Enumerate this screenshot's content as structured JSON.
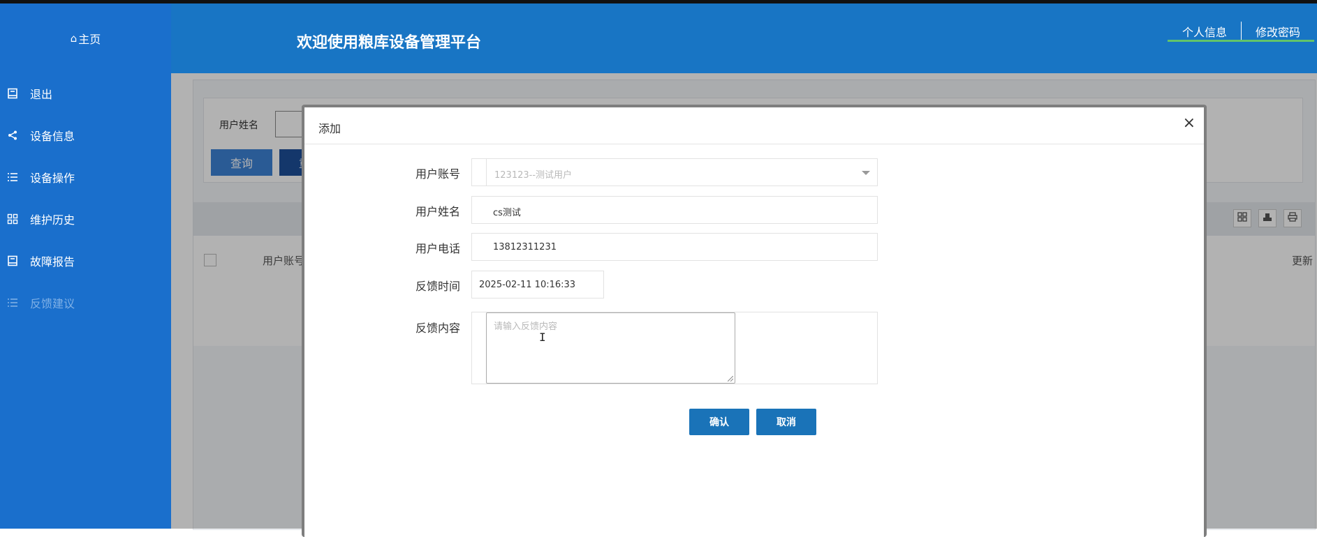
{
  "header": {
    "home_label": "主页",
    "title": "欢迎使用粮库设备管理平台",
    "links": [
      "个人信息",
      "修改密码"
    ]
  },
  "sidebar": {
    "items": [
      {
        "label": "退出",
        "icon": "book-icon"
      },
      {
        "label": "设备信息",
        "icon": "share-icon"
      },
      {
        "label": "设备操作",
        "icon": "list-icon"
      },
      {
        "label": "维护历史",
        "icon": "grid-icon"
      },
      {
        "label": "故障报告",
        "icon": "book-icon"
      },
      {
        "label": "反馈建议",
        "icon": "list-icon",
        "active": true
      }
    ]
  },
  "search": {
    "label": "用户姓名",
    "query_button": "查询",
    "reset_button": "重置"
  },
  "table": {
    "columns": [
      "用户账号",
      "更新"
    ]
  },
  "modal": {
    "title": "添加",
    "close": "×",
    "fields": {
      "account": {
        "label": "用户账号",
        "value": "123123--测试用户"
      },
      "name": {
        "label": "用户姓名",
        "value": "cs测试"
      },
      "phone": {
        "label": "用户电话",
        "value": "13812311231"
      },
      "time": {
        "label": "反馈时间",
        "value": "2025-02-11 10:16:33"
      },
      "content": {
        "label": "反馈内容",
        "placeholder": "请输入反馈内容",
        "value": ""
      }
    },
    "confirm_button": "确认",
    "cancel_button": "取消"
  },
  "colors": {
    "header": "#1875c4",
    "sidebar": "#1a6fcc",
    "primary_button": "#1a73b8",
    "active_underline": "#62c46a"
  }
}
